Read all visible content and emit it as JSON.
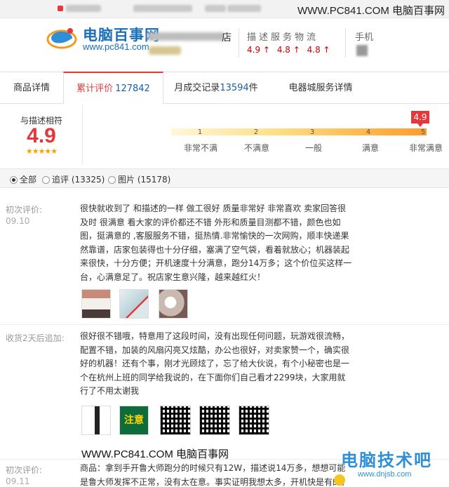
{
  "watermark": {
    "top_site": "WWW.PC841.COM 电脑百事网",
    "bottom_site": "WWW.PC841.COM 电脑百事网",
    "brand_cn": "电脑技术吧",
    "brand_url": "www.dnjsb.com"
  },
  "header": {
    "logo_title": "电脑百事网",
    "logo_url": "www.pc841.com",
    "store_suffix": "店",
    "score_heading": "描述服务物流",
    "scores": [
      "4.9",
      "4.8",
      "4.8"
    ],
    "arrow": "↑",
    "phone_label": "手机"
  },
  "tabs": [
    {
      "label": "商品详情",
      "count": ""
    },
    {
      "label": "累计评价",
      "count": "127842"
    },
    {
      "label": "月成交记录",
      "count": "13594",
      "suffix": "件"
    },
    {
      "label": "电器城服务详情",
      "count": ""
    }
  ],
  "rating": {
    "match_label": "与描述相符",
    "score": "4.9",
    "stars": "★★★★★",
    "pin_value": "4.9",
    "scale": [
      {
        "num": "1",
        "label": "非常不满"
      },
      {
        "num": "2",
        "label": "不满意"
      },
      {
        "num": "3",
        "label": "一般"
      },
      {
        "num": "4",
        "label": "满意"
      },
      {
        "num": "5",
        "label": "非常满意"
      }
    ]
  },
  "filters": [
    {
      "label": "全部",
      "selected": true
    },
    {
      "label": "追评 (13325)",
      "selected": false
    },
    {
      "label": "图片 (15178)",
      "selected": false
    }
  ],
  "reviews": [
    {
      "label": "初次评价:",
      "date": "09.10",
      "text": "很快就收到了 和描述的一样 做工很好 质量非常好 非常喜欢 卖家回答很及时 很满意 看大家的评价都还不错 外形和质量目测都不错，颜色也如图，挺满意的 ,客服服务不错，挺热情.非常愉快的一次网购，顺丰快递果然靠谱，店家包装得也十分仔细，塞满了空气袋，看着就放心；机器装起来很快，十分方便；开机速度十分满意，跑分14万多；这个价位买这样一台，心满意足了。祝店家生意兴隆，越来越红火！"
    },
    {
      "label": "收货2天后追加:",
      "date": "",
      "text": "很好很不错哦，特意用了这段时间，没有出现任何问题，玩游戏很流畅，配置不错，加装的风扇闪亮又炫酷，办公也很好，对卖家赞一个，确实很好的机器！还有个事，刚才光顾炫了，忘了给大伙说，有个小秘密也是一个在杭州上班的同学给我说的，在下面你们自己看才2299块，大家用就行了不用太谢我"
    },
    {
      "label": "初次评价:",
      "date": "09.11",
      "text": "商品：拿到手开鲁大师跑分的时候只有12W，描述说14万多，想想可能是鲁大师发挥不正常，没有太在意。事实证明我想太多，开机快是有的，但"
    }
  ],
  "thumb_labels": [
    "注意"
  ]
}
